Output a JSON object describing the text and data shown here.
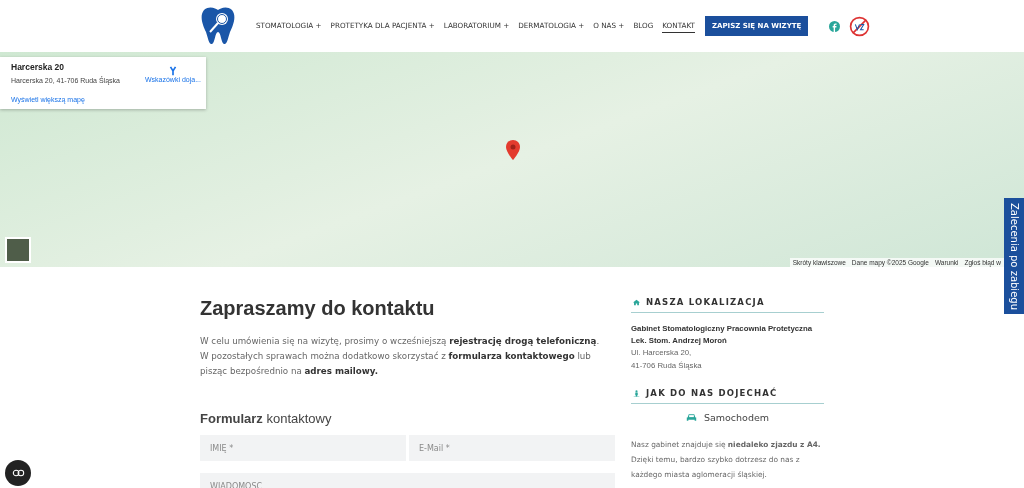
{
  "nav": {
    "items": [
      {
        "label": "STOMATOLOGIA +",
        "selected": false
      },
      {
        "label": "PROTETYKA DLA PACJENTA +",
        "selected": false
      },
      {
        "label": "LABORATORIUM +",
        "selected": false
      },
      {
        "label": "DERMATOLOGIA +",
        "selected": false
      },
      {
        "label": "O NAS +",
        "selected": false
      },
      {
        "label": "BLOG",
        "selected": false
      },
      {
        "label": "KONTAKT",
        "selected": true
      }
    ],
    "cta": "ZAPISZ SIĘ NA WIZYTĘ"
  },
  "map": {
    "card": {
      "title": "Harcerska 20",
      "address": "Harcerska 20, 41-706 Ruda Śląska",
      "directions": "Wskazówki doja...",
      "larger_map": "Wyświetl większą mapę"
    },
    "attribution": [
      "Skróty klawiszowe",
      "Dane mapy ©2025 Google",
      "Warunki",
      "Zgłoś błąd w"
    ]
  },
  "side_tab": "Zalecenia po zabiegu",
  "content": {
    "title": "Zapraszamy do kontaktu",
    "paragraphs": [
      "W celu umówienia się na wizytę, prosimy o wcześniejszą **rejestrację drogą telefoniczną**.",
      "W pozostałych sprawach można dodatkowo skorzystać z **formularza kontaktowego** lub pisząc bezpośrednio na **adres mailowy.**"
    ],
    "form_title": "**Formularz** kontaktowy",
    "fields": [
      {
        "placeholder": "IMIĘ *"
      },
      {
        "placeholder": "E-Mail *"
      },
      {
        "placeholder": "WIADOMOŚĆ"
      }
    ]
  },
  "sidebar": {
    "location_heading": "NASZA LOKALIZACJA",
    "clinic_name": "Gabinet Stomatologiczny Pracownia Protetyczna",
    "doctor": "Lek. Stom. Andrzej Moroń",
    "street": "Ul. Harcerska 20,",
    "city": "41-706 Ruda Śląska",
    "directions_heading": "JAK DO NAS DOJECHAĆ",
    "mode": "Samochodem",
    "directions_text": [
      "Nasz gabinet znajduje się **niedaleko zjazdu z A4.**",
      "Dzięki temu, bardzo szybko dotrzesz do nas z każdego miasta aglomeracji śląskiej."
    ]
  }
}
